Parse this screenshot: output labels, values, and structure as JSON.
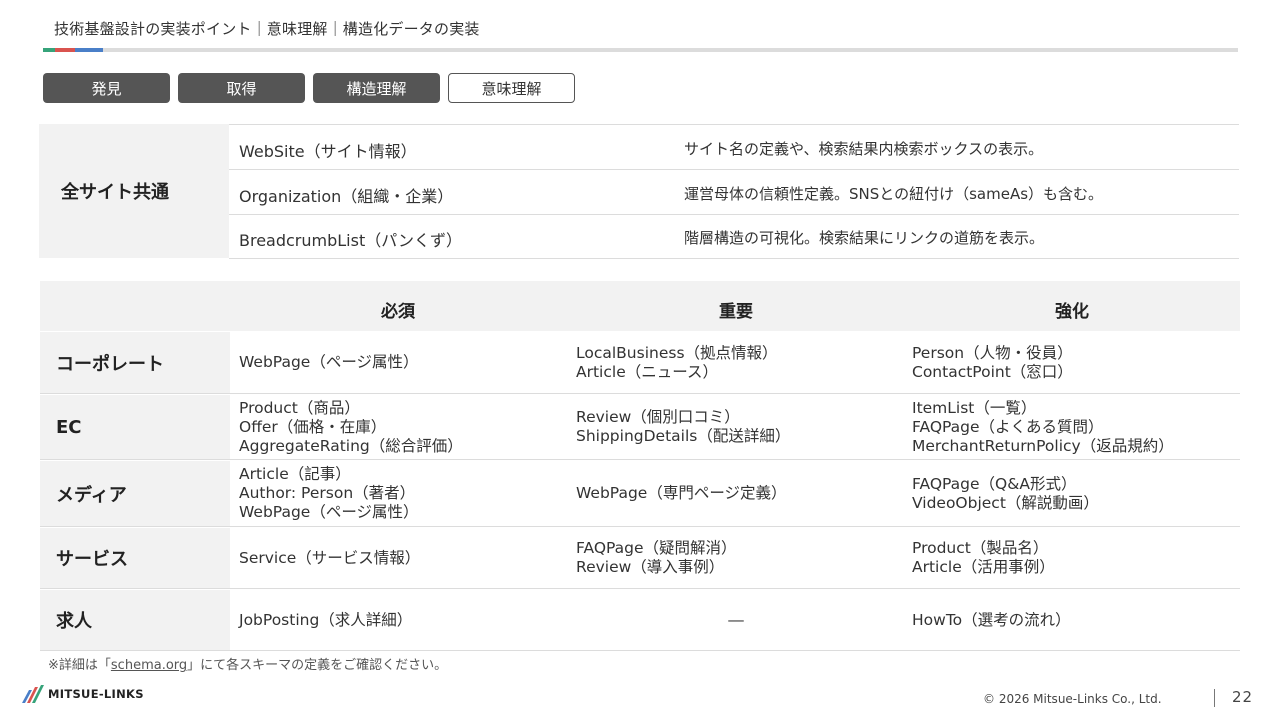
{
  "header": {
    "title": "技術基盤設計の実装ポイント｜意味理解｜構造化データの実装",
    "accent_colors": [
      "#36a37a",
      "#d9534f",
      "#4a7fc8"
    ]
  },
  "steps": [
    {
      "label": "発見",
      "state": "done"
    },
    {
      "label": "取得",
      "state": "done"
    },
    {
      "label": "構造理解",
      "state": "done"
    },
    {
      "label": "意味理解",
      "state": "current"
    }
  ],
  "common_table": {
    "heading": "全サイト共通",
    "rows": [
      {
        "type": "WebSite（サイト情報）",
        "description": "サイト名の定義や、検索結果内検索ボックスの表示。"
      },
      {
        "type": "Organization（組織・企業）",
        "description": "運営母体の信頼性定義。SNSとの紐付け（sameAs）も含む。"
      },
      {
        "type": "BreadcrumbList（パンくず）",
        "description": "階層構造の可視化。検索結果にリンクの道筋を表示。"
      }
    ]
  },
  "category_table": {
    "columns": [
      "必須",
      "重要",
      "強化"
    ],
    "rows": [
      {
        "label": "コーポレート",
        "required": [
          "WebPage（ページ属性）"
        ],
        "important": [
          "LocalBusiness（拠点情報）",
          "Article（ニュース）"
        ],
        "enhanced": [
          "Person（人物・役員）",
          "ContactPoint（窓口）"
        ]
      },
      {
        "label": "EC",
        "required": [
          "Product（商品）",
          "Offer（価格・在庫）",
          "AggregateRating（総合評価）"
        ],
        "important": [
          "Review（個別口コミ）",
          "ShippingDetails（配送詳細）"
        ],
        "enhanced": [
          "ItemList（一覧）",
          "FAQPage（よくある質問）",
          "MerchantReturnPolicy（返品規約）"
        ]
      },
      {
        "label": "メディア",
        "required": [
          "Article（記事）",
          "Author: Person（著者）",
          "WebPage（ページ属性）"
        ],
        "important": [
          "WebPage（専門ページ定義）"
        ],
        "enhanced": [
          "FAQPage（Q&A形式）",
          "VideoObject（解説動画）"
        ]
      },
      {
        "label": "サービス",
        "required": [
          "Service（サービス情報）"
        ],
        "important": [
          "FAQPage（疑問解消）",
          "Review（導入事例）"
        ],
        "enhanced": [
          "Product（製品名）",
          "Article（活用事例）"
        ]
      },
      {
        "label": "求人",
        "required": [
          "JobPosting（求人詳細）"
        ],
        "important": [
          "―"
        ],
        "enhanced": [
          "HowTo（選考の流れ）"
        ]
      }
    ]
  },
  "footnote": {
    "prefix": "※詳細は「",
    "link": "schema.org",
    "suffix": "」にて各スキーマの定義をご確認ください。"
  },
  "footer": {
    "logo_text": "MITSUE-LINKS",
    "copyright": "© 2026 Mitsue-Links Co., Ltd.",
    "page_number": "22"
  }
}
